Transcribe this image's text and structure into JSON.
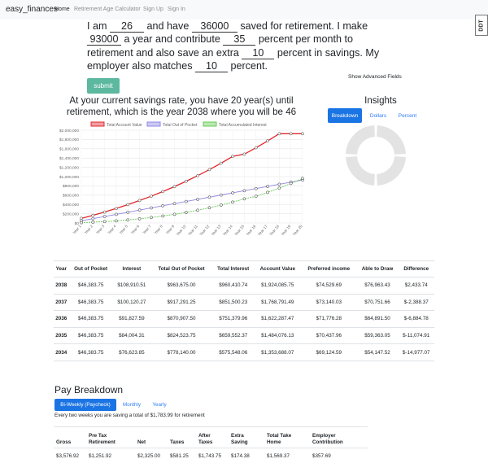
{
  "nav": {
    "brand": "easy_finances",
    "links": [
      "Home",
      "Retirement Age Calculator",
      "Sign Up",
      "Sign In"
    ]
  },
  "badge": "DDT",
  "form": {
    "t1": "I am",
    "age": "26",
    "t2": "and have",
    "savings": "36000",
    "t3": "saved for retirement. I make",
    "income": "93000",
    "t4": "a year and contribute",
    "contribution": "35",
    "t5": "percent per month to retirement and also save an extra",
    "extra": "10",
    "t6": "percent in savings. My employer also matches",
    "match": "10",
    "t7": "percent.",
    "submit": "submit",
    "advanced": "Show Advanced Fields"
  },
  "summary": "At your current savings rate, you have 20 year(s) until retirement, which is the year 2038 where you will be 46",
  "insights": {
    "title": "Insights",
    "tabs": [
      "Breakdown",
      "Dollars",
      "Percent"
    ],
    "active_tab": "Breakdown",
    "donut_color": "#e3e3e3"
  },
  "chart_data": {
    "type": "line",
    "x": [
      "Year 1",
      "Year 2",
      "Year 3",
      "Year 4",
      "Year 5",
      "Year 6",
      "Year 7",
      "Year 8",
      "Year 9",
      "Year 10",
      "Year 11",
      "Year 12",
      "Year 13",
      "Year 14",
      "Year 15",
      "Year 16",
      "Year 17",
      "Year 18",
      "Year 19",
      "Year 20"
    ],
    "ylim": [
      0,
      2000000
    ],
    "yticks": [
      "$0",
      "$200,000",
      "$400,000",
      "$600,000",
      "$800,000",
      "$1,000,000",
      "$1,200,000",
      "$1,400,000",
      "$1,600,000",
      "$1,800,000",
      "$2,000,000"
    ],
    "grid": true,
    "legend_position": "top",
    "series": [
      {
        "name": "Total Account Value",
        "color": "#e0282c",
        "values": [
          99000,
          165000,
          236000,
          313000,
          396000,
          484000,
          578000,
          678000,
          785000,
          899000,
          1021000,
          1151000,
          1289000,
          1436000,
          1484076,
          1622287,
          1768791,
          1924085,
          1924085,
          1924085
        ]
      },
      {
        "name": "Total Out of Pocket",
        "color": "#8e87e6",
        "values": [
          46384,
          92768,
          139151,
          185535,
          231919,
          278303,
          324687,
          371070,
          417454,
          463838,
          510222,
          556605,
          602989,
          649373,
          695757,
          742141,
          788524,
          834908,
          881292,
          927676
        ]
      },
      {
        "name": "Total Accumulated Interest",
        "color": "#66cc55",
        "values": [
          7000,
          17000,
          30000,
          46000,
          66000,
          90000,
          118000,
          150000,
          187000,
          228000,
          275000,
          328000,
          386000,
          450000,
          520000,
          575548,
          659552,
          751380,
          851500,
          960411
        ]
      }
    ]
  },
  "table": {
    "headers": [
      "Year",
      "Out of Pocket",
      "Interest",
      "Total Out of Pocket",
      "Total Interest",
      "Account Value",
      "Preferred income",
      "Able to Draw",
      "Difference"
    ],
    "rows": [
      [
        "2038",
        "$46,383.75",
        "$108,910.51",
        "$963,675.00",
        "$960,410.74",
        "$1,924,085.75",
        "$74,529.69",
        "$76,963.43",
        "$2,433.74"
      ],
      [
        "2037",
        "$46,383.75",
        "$100,120.27",
        "$917,291.25",
        "$851,500.23",
        "$1,768,791.49",
        "$73,140.03",
        "$70,751.66",
        "$-2,388.37"
      ],
      [
        "2036",
        "$46,383.75",
        "$91,827.59",
        "$870,907.50",
        "$751,379.96",
        "$1,622,287.47",
        "$71,776.28",
        "$64,891.50",
        "$-6,884.78"
      ],
      [
        "2035",
        "$46,383.75",
        "$84,004.31",
        "$824,523.75",
        "$659,552.37",
        "$1,484,076.13",
        "$70,437.96",
        "$59,363.05",
        "$-11,074.91"
      ],
      [
        "2034",
        "$46,383.75",
        "$76,623.85",
        "$778,140.00",
        "$575,548.06",
        "$1,353,688.07",
        "$69,124.59",
        "$54,147.52",
        "$-14,977.07"
      ]
    ]
  },
  "pay": {
    "title": "Pay Breakdown",
    "tabs": [
      "Bi-Weekly (Paycheck)",
      "Monthly",
      "Yearly"
    ],
    "active_tab": "Bi-Weekly (Paycheck)",
    "note": "Every two weeks you are saving a total of $1,783.99 for retirement",
    "headers": [
      [
        "Gross"
      ],
      [
        "Pre Tax",
        "Retirement"
      ],
      [
        "Net"
      ],
      [
        "Taxes"
      ],
      [
        "After",
        "Taxes"
      ],
      [
        "Extra",
        "Saving"
      ],
      [
        "Total Take",
        "Home"
      ],
      [
        "Employer",
        "Contribution"
      ]
    ],
    "row": [
      "$3,576.92",
      "$1,251.92",
      "$2,325.00",
      "$581.25",
      "$1,743.75",
      "$174.38",
      "$1,569.37",
      "$357.69"
    ]
  }
}
